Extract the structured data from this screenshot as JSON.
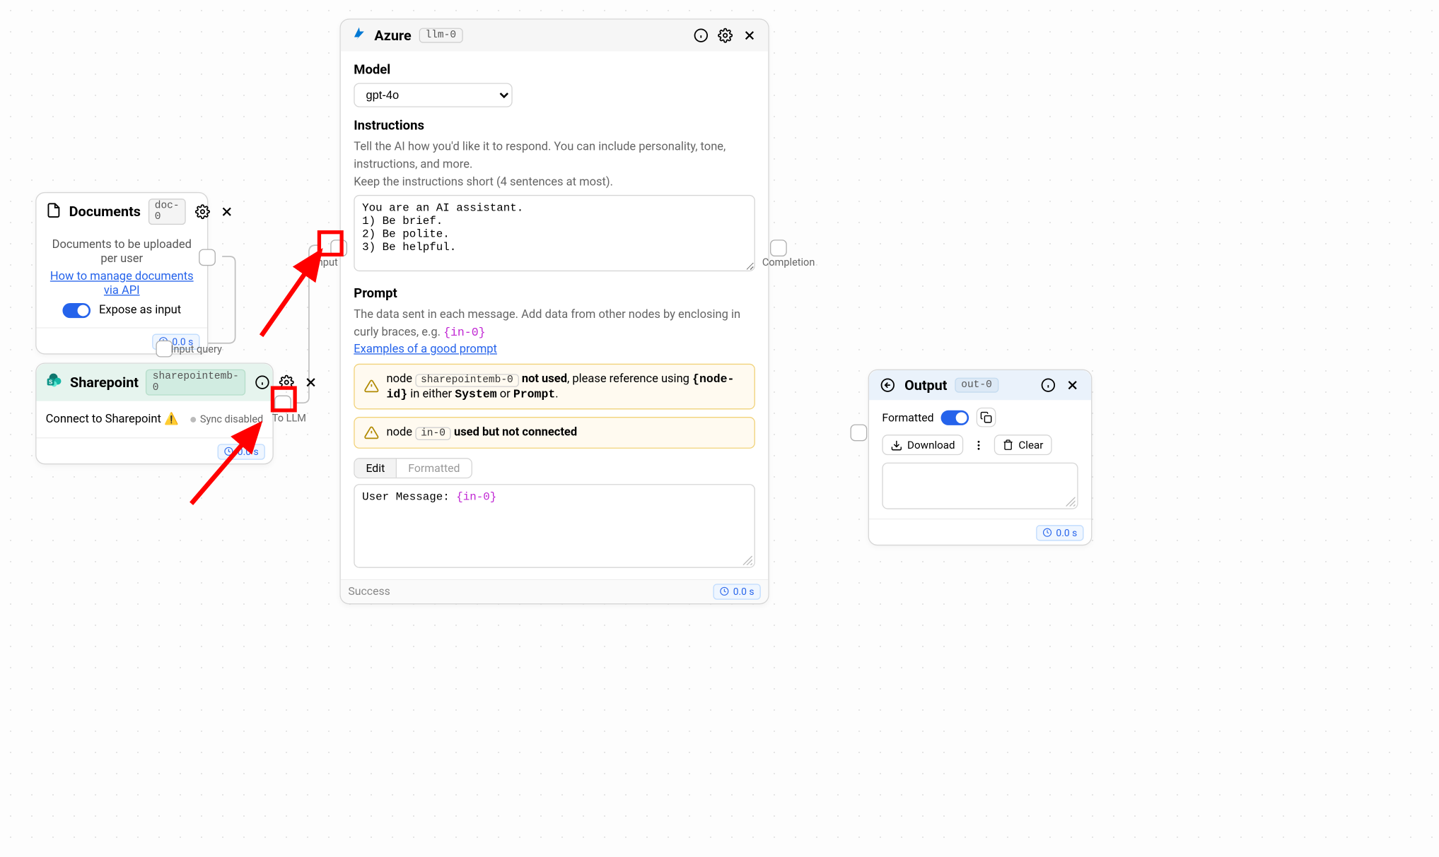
{
  "documents": {
    "title": "Documents",
    "id": "doc-0",
    "body_text": "Documents to be uploaded per user",
    "link_text": "How to manage documents via API",
    "expose_label": "Expose as input",
    "timing": "0.0 s",
    "port_label": "Input query"
  },
  "sharepoint": {
    "title": "Sharepoint",
    "id": "sharepointemb-0",
    "connect_text": "Connect to Sharepoint",
    "status_text": "Sync disabled",
    "timing": "0.0 s",
    "port_label": "To LLM"
  },
  "azure": {
    "title": "Azure",
    "id": "llm-0",
    "model_label": "Model",
    "model_value": "gpt-4o",
    "instructions_label": "Instructions",
    "instructions_hint1": "Tell the AI how you'd like it to respond. You can include personality, tone, instructions, and more.",
    "instructions_hint2": "Keep the instructions short (4 sentences at most).",
    "instructions_value": "You are an AI assistant.\n1) Be brief.\n2) Be polite.\n3) Be helpful.",
    "prompt_label": "Prompt",
    "prompt_hint_pre": "The data sent in each message. Add data from other nodes by enclosing in curly braces, e.g. ",
    "prompt_hint_code": "{in-0}",
    "prompt_link": "Examples of a good prompt",
    "warn1_pre": "node ",
    "warn1_chip": "sharepointemb-0",
    "warn1_bold": " not used",
    "warn1_post": ", please reference using ",
    "warn1_code1": "{node-id}",
    "warn1_mid": " in either ",
    "warn1_code2": "System",
    "warn1_or": " or ",
    "warn1_code3": "Prompt",
    "warn2_pre": "node ",
    "warn2_chip": "in-0",
    "warn2_bold": " used but not connected",
    "tab_edit": "Edit",
    "tab_formatted": "Formatted",
    "prompt_value_pre": "User Message: ",
    "prompt_value_token": "{in-0}",
    "footer_status": "Success",
    "timing": "0.0 s",
    "input_port_label": "Input",
    "output_port_label": "Completion"
  },
  "output": {
    "title": "Output",
    "id": "out-0",
    "formatted_label": "Formatted",
    "download_label": "Download",
    "clear_label": "Clear",
    "timing": "0.0 s"
  }
}
